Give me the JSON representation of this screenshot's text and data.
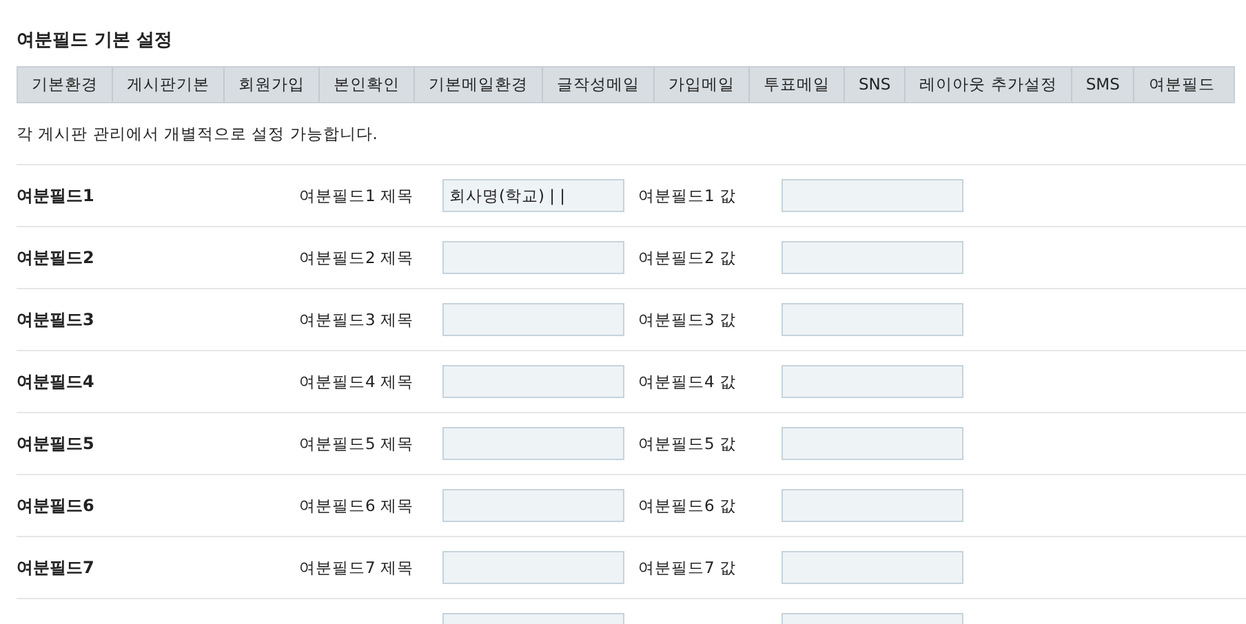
{
  "title": "여분필드 기본 설정",
  "tabs": [
    {
      "label": "기본환경"
    },
    {
      "label": "게시판기본"
    },
    {
      "label": "회원가입"
    },
    {
      "label": "본인확인"
    },
    {
      "label": "기본메일환경"
    },
    {
      "label": "글작성메일"
    },
    {
      "label": "가입메일"
    },
    {
      "label": "투표메일"
    },
    {
      "label": "SNS"
    },
    {
      "label": "레이아웃 추가설정"
    },
    {
      "label": "SMS"
    },
    {
      "label": "여분필드"
    }
  ],
  "description": "각 게시판 관리에서 개별적으로 설정 가능합니다.",
  "rows": [
    {
      "name": "여분필드1",
      "title_label": "여분필드1 제목",
      "title_value": "회사명(학교) | |",
      "value_label": "여분필드1 값",
      "value": ""
    },
    {
      "name": "여분필드2",
      "title_label": "여분필드2 제목",
      "title_value": "",
      "value_label": "여분필드2 값",
      "value": ""
    },
    {
      "name": "여분필드3",
      "title_label": "여분필드3 제목",
      "title_value": "",
      "value_label": "여분필드3 값",
      "value": ""
    },
    {
      "name": "여분필드4",
      "title_label": "여분필드4 제목",
      "title_value": "",
      "value_label": "여분필드4 값",
      "value": ""
    },
    {
      "name": "여분필드5",
      "title_label": "여분필드5 제목",
      "title_value": "",
      "value_label": "여분필드5 값",
      "value": ""
    },
    {
      "name": "여분필드6",
      "title_label": "여분필드6 제목",
      "title_value": "",
      "value_label": "여분필드6 값",
      "value": ""
    },
    {
      "name": "여분필드7",
      "title_label": "여분필드7 제목",
      "title_value": "",
      "value_label": "여분필드7 값",
      "value": ""
    },
    {
      "title_value": "",
      "value": ""
    }
  ]
}
